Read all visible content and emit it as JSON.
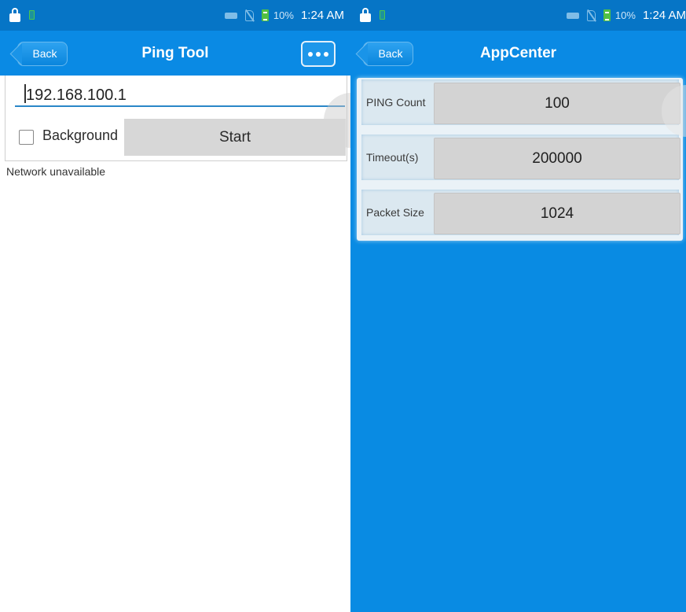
{
  "status_bar": {
    "battery_pct": "10%",
    "time": "1:24 AM"
  },
  "ping_screen": {
    "back_label": "Back",
    "title": "Ping Tool",
    "ip_value": "192.168.100.1",
    "background_label": "Background",
    "background_checked": false,
    "start_label": "Start",
    "status_message": "Network unavailable",
    "more_icon": "more-dots-icon"
  },
  "appcenter_screen": {
    "back_label": "Back",
    "title": "AppCenter",
    "settings": [
      {
        "label": "PING Count",
        "value": "100"
      },
      {
        "label": "Timeout(s)",
        "value": "200000"
      },
      {
        "label": "Packet Size",
        "value": "1024"
      }
    ]
  },
  "colors": {
    "status_bar": "#0675c6",
    "title_bar": "#0a8ae4",
    "accent_underline": "#2a87c8",
    "button_gray": "#d7d7d7"
  }
}
